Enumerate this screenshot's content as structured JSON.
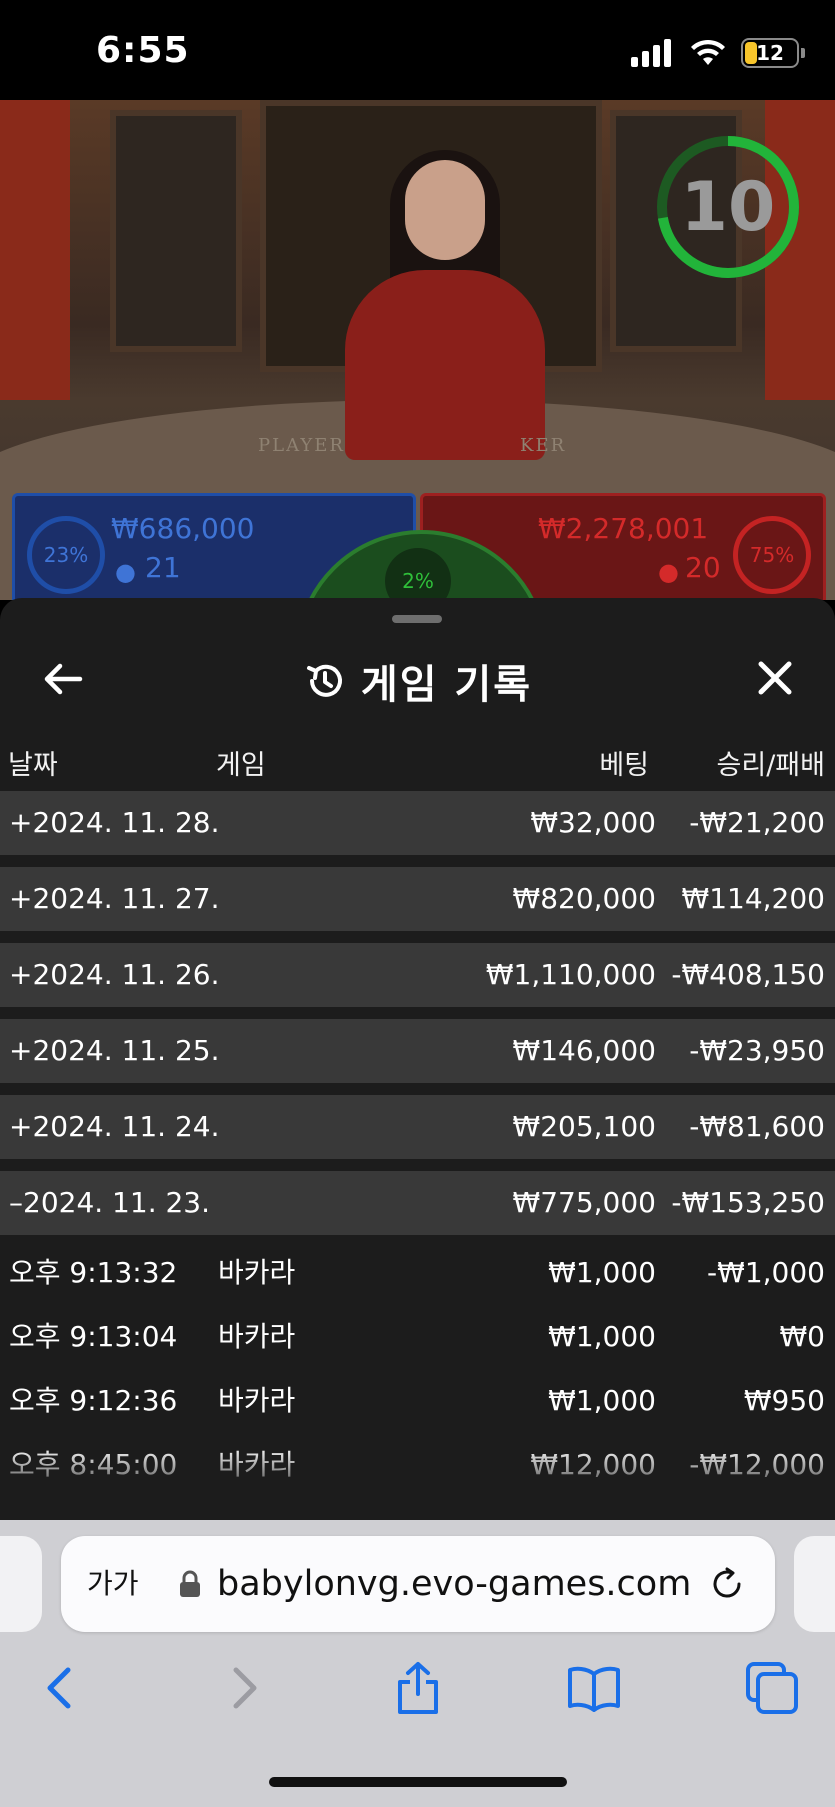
{
  "status_bar": {
    "time": "6:55",
    "battery": "12"
  },
  "game": {
    "timer": "10",
    "table_player_text": "PLAYER",
    "table_banker_text": "KER",
    "player": {
      "percent": "23%",
      "amount": "₩686,000",
      "count": "21",
      "color": "#1f4ea8"
    },
    "banker": {
      "percent": "75%",
      "amount": "₩2,278,001",
      "count": "20",
      "color": "#d42a2a"
    },
    "tie": {
      "percent": "2%"
    }
  },
  "sheet": {
    "title": "게임 기록",
    "columns": {
      "date": "날짜",
      "game": "게임",
      "bet": "베팅",
      "win_loss": "승리/패배"
    },
    "date_rows": [
      {
        "date": "+2024. 11. 28.",
        "bet": "₩32,000",
        "result": "-₩21,200"
      },
      {
        "date": "+2024. 11. 27.",
        "bet": "₩820,000",
        "result": "₩114,200"
      },
      {
        "date": "+2024. 11. 26.",
        "bet": "₩1,110,000",
        "result": "-₩408,150"
      },
      {
        "date": "+2024. 11. 25.",
        "bet": "₩146,000",
        "result": "-₩23,950"
      },
      {
        "date": "+2024. 11. 24.",
        "bet": "₩205,100",
        "result": "-₩81,600"
      },
      {
        "date": "–2024. 11. 23.",
        "bet": "₩775,000",
        "result": "-₩153,250"
      }
    ],
    "detail_rows": [
      {
        "time": "오후 9:13:32",
        "game": "바카라",
        "bet": "₩1,000",
        "result": "-₩1,000"
      },
      {
        "time": "오후 9:13:04",
        "game": "바카라",
        "bet": "₩1,000",
        "result": "₩0"
      },
      {
        "time": "오후 9:12:36",
        "game": "바카라",
        "bet": "₩1,000",
        "result": "₩950"
      },
      {
        "time": "오후 8:45:00",
        "game": "바카라",
        "bet": "₩12,000",
        "result": "-₩12,000"
      }
    ]
  },
  "browser": {
    "text_size_label": "가가",
    "url": "babylonvg.evo-games.com",
    "accent": "#1a6fe8"
  }
}
